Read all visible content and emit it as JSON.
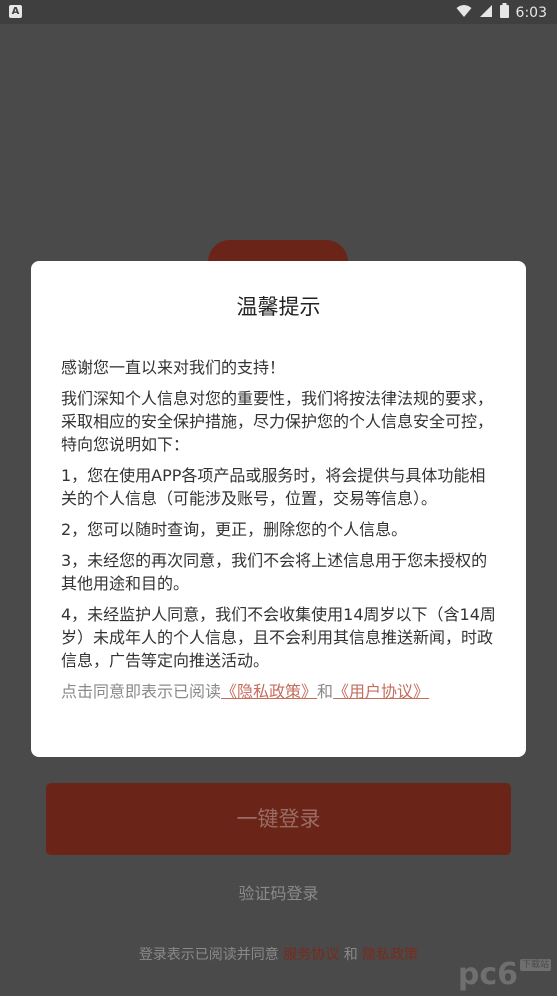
{
  "status_bar": {
    "app_icon_label": "A",
    "time": "6:03"
  },
  "background": {
    "login_button": "一键登录",
    "sms_login": "验证码登录",
    "footer": {
      "prefix": "登录表示已阅读并同意",
      "service_link": "服务协议",
      "and": "和",
      "privacy_link": "隐私政策"
    },
    "watermark": "pc6",
    "watermark_sub": "下载站"
  },
  "dialog": {
    "title": "温馨提示",
    "paragraphs": [
      "感谢您一直以来对我们的支持！",
      "我们深知个人信息对您的重要性，我们将按法律法规的要求，采取相应的安全保护措施，尽力保护您的个人信息安全可控，特向您说明如下：",
      "1，您在使用APP各项产品或服务时，将会提供与具体功能相关的个人信息（可能涉及账号，位置，交易等信息）。",
      "2，您可以随时查询，更正，删除您的个人信息。",
      "3，未经您的再次同意，我们不会将上述信息用于您未授权的其他用途和目的。",
      "4，未经监护人同意，我们不会收集使用14周岁以下（含14周岁）未成年人的个人信息，且不会利用其信息推送新闻，时政信息，广告等定向推送活动。"
    ],
    "consent": {
      "prefix": "点击同意即表示已阅读",
      "privacy_link": "《隐私政策》",
      "and": "和",
      "user_link": "《用户协议》"
    }
  },
  "colors": {
    "accent": "#c56c5d",
    "brand_dim": "#6a2418",
    "overlay": "#4a4a4a"
  }
}
